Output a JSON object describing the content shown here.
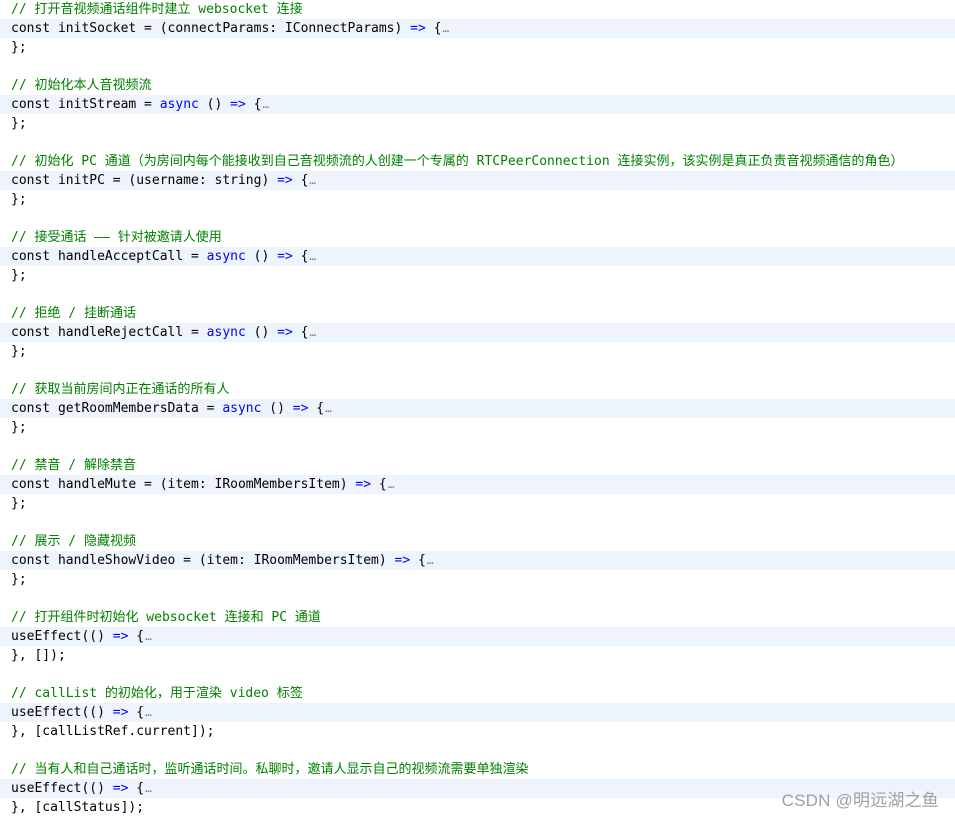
{
  "blocks": [
    {
      "comment": "// 打开音视频通话组件时建立 websocket 连接",
      "head": "const initSocket = (connectParams: IConnectParams) => {",
      "tail": "};"
    },
    {
      "comment": "// 初始化本人音视频流",
      "head": "const initStream = async () => {",
      "tail": "};"
    },
    {
      "comment": "// 初始化 PC 通道（为房间内每个能接收到自己音视频流的人创建一个专属的 RTCPeerConnection 连接实例，该实例是真正负责音视频通信的角色）",
      "head": "const initPC = (username: string) => {",
      "tail": "};"
    },
    {
      "comment": "// 接受通话 —— 针对被邀请人使用",
      "head": "const handleAcceptCall = async () => {",
      "tail": "};"
    },
    {
      "comment": "// 拒绝 / 挂断通话",
      "head": "const handleRejectCall = async () => {",
      "tail": "};"
    },
    {
      "comment": "// 获取当前房间内正在通话的所有人",
      "head": "const getRoomMembersData = async () => {",
      "tail": "};"
    },
    {
      "comment": "// 禁音 / 解除禁音",
      "head": "const handleMute = (item: IRoomMembersItem) => {",
      "tail": "};"
    },
    {
      "comment": "// 展示 / 隐藏视频",
      "head": "const handleShowVideo = (item: IRoomMembersItem) => {",
      "tail": "};"
    },
    {
      "comment": "// 打开组件时初始化 websocket 连接和 PC 通道",
      "head": "useEffect(() => {",
      "tail": "}, []);"
    },
    {
      "comment": "// callList 的初始化，用于渲染 video 标签",
      "head": "useEffect(() => {",
      "tail": "}, [callListRef.current]);"
    },
    {
      "comment": "// 当有人和自己通话时，监听通话时间。私聊时，邀请人显示自己的视频流需要单独渲染",
      "head": "useEffect(() => {",
      "tail": "}, [callStatus]);"
    }
  ],
  "fold_marker": "…",
  "watermark": "CSDN @明远湖之鱼"
}
